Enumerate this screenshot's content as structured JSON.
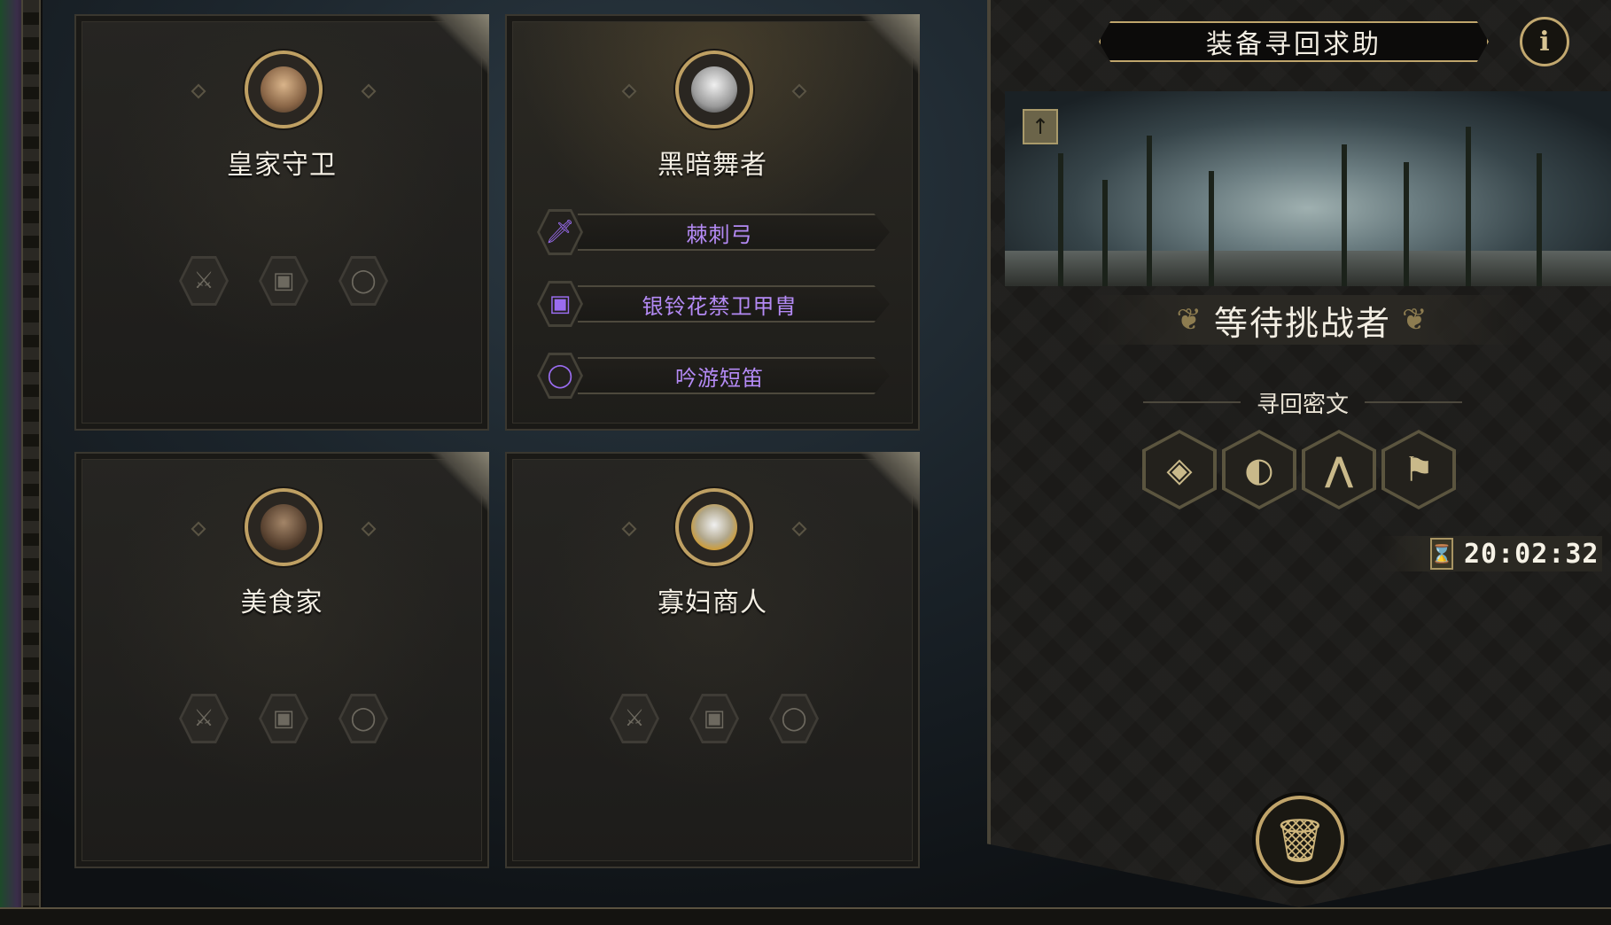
{
  "cards": [
    {
      "name": "皇家守卫",
      "highlighted": false,
      "equipment": [],
      "empty_slots": [
        "weapon",
        "armor",
        "accessory"
      ]
    },
    {
      "name": "黑暗舞者",
      "highlighted": true,
      "equipment": [
        {
          "type": "weapon",
          "name": "棘刺弓",
          "icon": "sword-icon"
        },
        {
          "type": "armor",
          "name": "银铃花禁卫甲胄",
          "icon": "armor-icon"
        },
        {
          "type": "accessory",
          "name": "吟游短笛",
          "icon": "ring-icon"
        }
      ],
      "empty_slots": []
    },
    {
      "name": "美食家",
      "highlighted": false,
      "equipment": [],
      "empty_slots": [
        "weapon",
        "armor",
        "accessory"
      ]
    },
    {
      "name": "寡妇商人",
      "highlighted": false,
      "equipment": [],
      "empty_slots": [
        "weapon",
        "armor",
        "accessory"
      ]
    }
  ],
  "panel": {
    "title": "装备寻回求助",
    "info_icon": "info-icon",
    "status": "等待挑战者",
    "cipher_label": "寻回密文",
    "runes": [
      "rune-1",
      "rune-2",
      "rune-3",
      "rune-4"
    ],
    "timer": "20:02:32",
    "timer_icon": "hourglass-icon",
    "trash_icon": "trash-icon"
  },
  "colors": {
    "accent_gold": "#bfa56c",
    "equipment_purple": "#b48af5"
  }
}
